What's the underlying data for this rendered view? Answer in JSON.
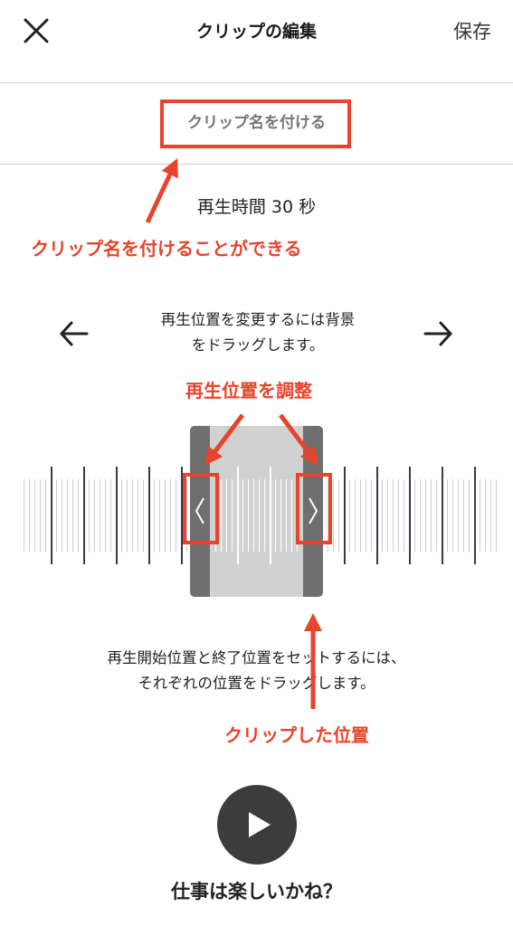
{
  "header": {
    "title": "クリップの編集",
    "save_label": "保存"
  },
  "clip_name": {
    "label": "クリップ名を付ける"
  },
  "duration": {
    "label": "再生時間 30 秒"
  },
  "instructions": {
    "drag_background_line1": "再生位置を変更するには背景",
    "drag_background_line2": "をドラッグします。",
    "set_positions_line1": "再生開始位置と終了位置をセットするには、",
    "set_positions_line2": "それぞれの位置をドラッグします。"
  },
  "track": {
    "title": "仕事は楽しいかね？"
  },
  "annotations": {
    "clip_name_note": "クリップ名を付けることができる",
    "adjust_note": "再生位置を調整",
    "clipped_note": "クリップした位置"
  },
  "colors": {
    "annotation_red": "#e8442b",
    "handle_gray": "#6f6f6f",
    "clip_fill": "#d1d1d1",
    "play_button": "#3c3c3c"
  }
}
